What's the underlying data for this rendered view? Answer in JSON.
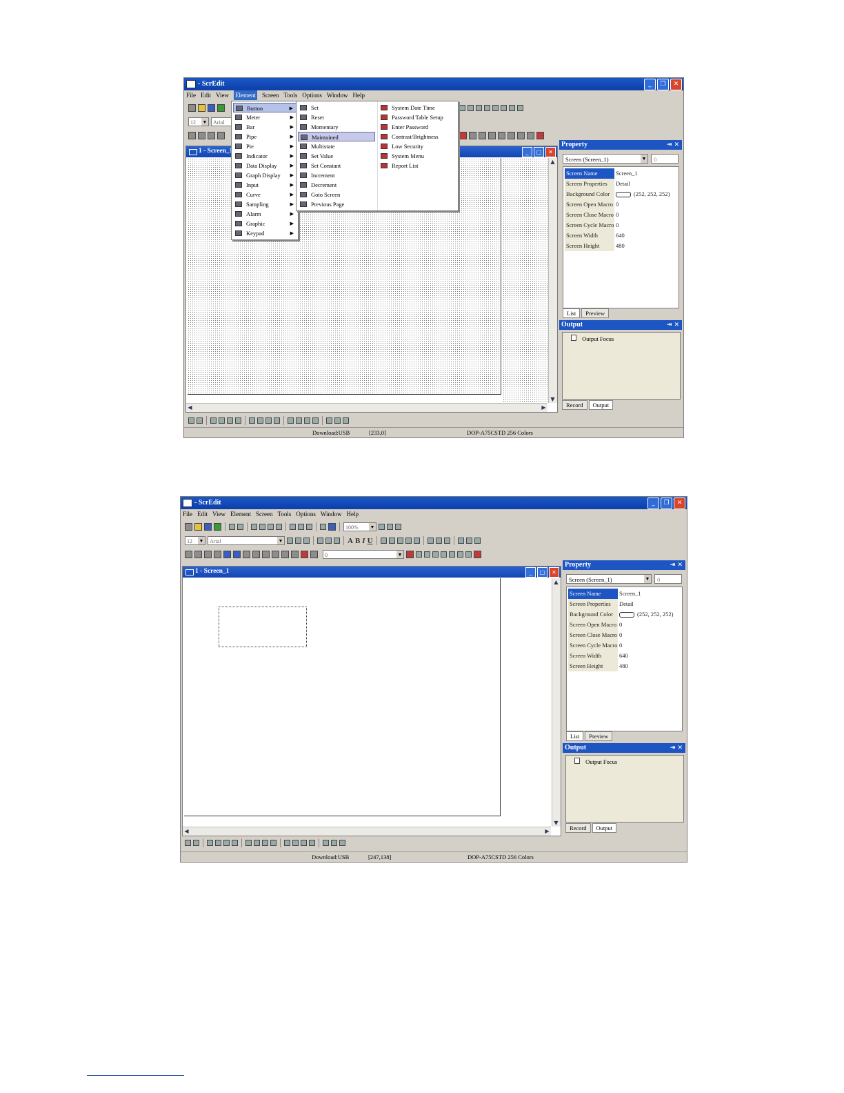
{
  "app_title": "- ScrEdit",
  "menubar": [
    "File",
    "Edit",
    "View",
    "Element",
    "Screen",
    "Tools",
    "Options",
    "Window",
    "Help"
  ],
  "child_window_title": "1 - Screen_1",
  "element_menu": [
    "Button",
    "Meter",
    "Bar",
    "Pipe",
    "Pie",
    "Indicator",
    "Data Display",
    "Graph Display",
    "Input",
    "Curve",
    "Sampling",
    "Alarm",
    "Graphic",
    "Keypad"
  ],
  "button_submenu": [
    "Set",
    "Reset",
    "Momentary",
    "Maintained",
    "Multistate",
    "Set Value",
    "Set Constant",
    "Increment",
    "Decrement",
    "Goto Screen",
    "Previous Page"
  ],
  "system_submenu": [
    "System Date Time",
    "Password Table Setup",
    "Enter Password",
    "Contrast/Brightness",
    "Low Security",
    "System Menu",
    "Report List"
  ],
  "toolbar": {
    "font_size": "12",
    "font_name": "Arial",
    "zoom": "100%",
    "style_A": "A",
    "style_B": "B",
    "style_I": "I",
    "style_U": "U",
    "state_combo": "0"
  },
  "property_panel": {
    "title": "Property",
    "selector": "Screen (Screen_1)",
    "index": "0",
    "rows": [
      {
        "key": "Screen Name",
        "value": "Screen_1"
      },
      {
        "key": "Screen Properties",
        "value": "Detail"
      },
      {
        "key": "Background Color",
        "value": "(252, 252, 252)"
      },
      {
        "key": "Screen Open Macro",
        "value": "0"
      },
      {
        "key": "Screen Close Macro",
        "value": "0"
      },
      {
        "key": "Screen Cycle Macro",
        "value": "0"
      },
      {
        "key": "Screen Width",
        "value": "640"
      },
      {
        "key": "Screen Height",
        "value": "480"
      }
    ],
    "tabs": [
      "List",
      "Preview"
    ]
  },
  "output_panel": {
    "title": "Output",
    "item": "Output Focus",
    "tabs": [
      "Record",
      "Output"
    ]
  },
  "status_top": {
    "download": "Download:USB",
    "coords": "[233,0]",
    "model": "DOP-A75CSTD 256 Colors"
  },
  "status_bottom": {
    "download": "Download:USB",
    "coords": "[247,138]",
    "model": "DOP-A75CSTD 256 Colors"
  },
  "colors": {
    "titlebar": "#0d3fa8",
    "chrome": "#d4d0c8",
    "selection": "#316ac5",
    "menu_highlight": "#c7c9e8"
  }
}
